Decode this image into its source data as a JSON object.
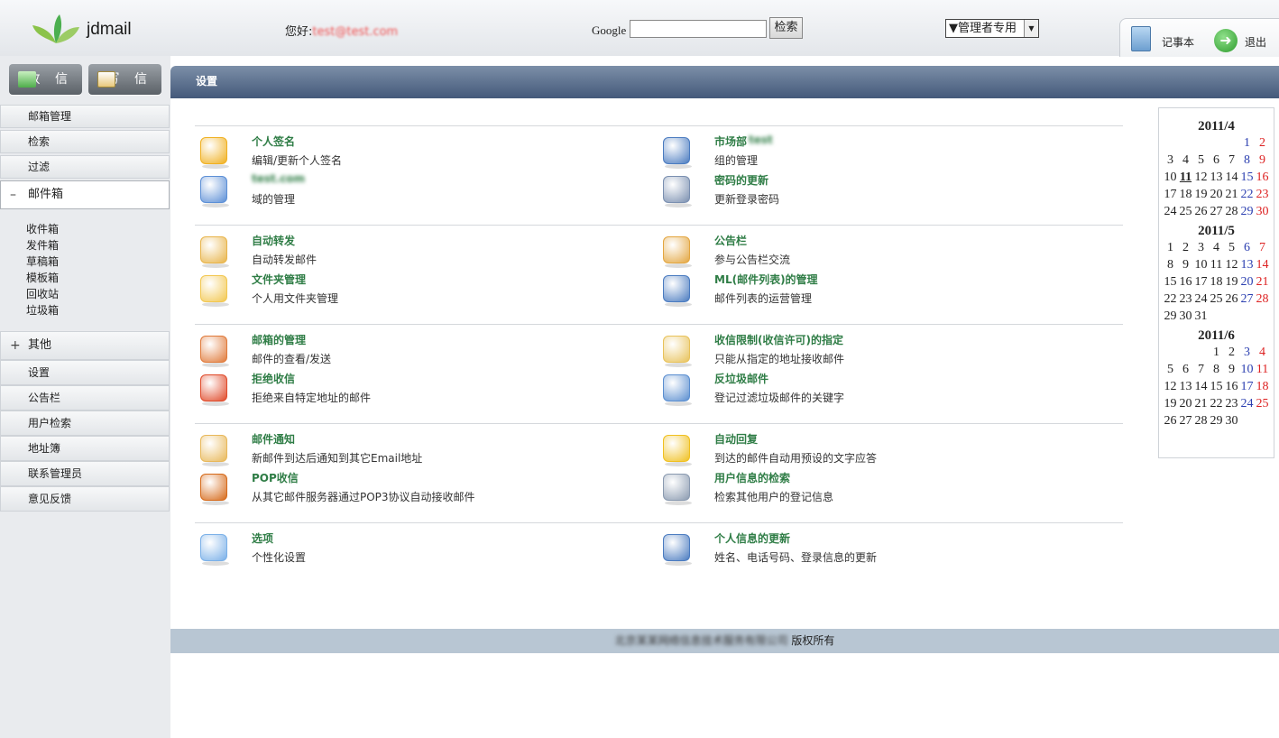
{
  "header": {
    "app_name": "jdmail",
    "greeting_label": "您好:",
    "greeting_user": "test@test.com",
    "google_label": "Google",
    "search_value": "",
    "search_button": "检索",
    "admin_select": "▼管理者专用",
    "notebook_label": "记事本",
    "exit_label": "退出"
  },
  "sidebar": {
    "receive_label": "收 信",
    "write_label": "写 信",
    "items": [
      "邮箱管理",
      "检索",
      "过滤"
    ],
    "mailbox_label": "邮件箱",
    "mailbox_sign": "–",
    "folders": [
      "收件箱",
      "发件箱",
      "草稿箱",
      "模板箱",
      "回收站",
      "垃圾箱"
    ],
    "other_label": "其他",
    "other_sign": "+",
    "other_items": [
      "设置",
      "公告栏",
      "用户检索",
      "地址簿",
      "联系管理员",
      "意见反馈"
    ]
  },
  "main": {
    "title": "设置",
    "rows": [
      {
        "left": [
          {
            "title": "个人签名",
            "desc": "编辑/更新个人签名",
            "icon": "signature-icon",
            "color": "#f0b020"
          },
          {
            "title": "test.com",
            "desc": "域的管理",
            "icon": "domain-card-icon",
            "color": "#5c8fd6",
            "blurred": true
          }
        ],
        "right": [
          {
            "title": "市场部",
            "title_extra": "test",
            "desc": "组的管理",
            "icon": "group-user-icon",
            "color": "#4a7bc0"
          },
          {
            "title": "密码的更新",
            "desc": "更新登录密码",
            "icon": "password-icon",
            "color": "#7a8fb0"
          }
        ]
      },
      {
        "left": [
          {
            "title": "自动转发",
            "desc": "自动转发邮件",
            "icon": "forward-icon",
            "color": "#e8b44a"
          },
          {
            "title": "文件夹管理",
            "desc": "个人用文件夹管理",
            "icon": "folder-icon",
            "color": "#f2c750"
          }
        ],
        "right": [
          {
            "title": "公告栏",
            "desc": "参与公告栏交流",
            "icon": "bulletin-icon",
            "color": "#e3a640"
          },
          {
            "title": "ML(邮件列表)的管理",
            "desc": "邮件列表的运营管理",
            "icon": "mailing-list-icon",
            "color": "#4a7bc0"
          }
        ]
      },
      {
        "left": [
          {
            "title": "邮箱的管理",
            "desc": "邮件的查看/发送",
            "icon": "mailbox-icon",
            "color": "#e07a3a"
          },
          {
            "title": "拒绝收信",
            "desc": "拒绝来自特定地址的邮件",
            "icon": "reject-mail-icon",
            "color": "#e04a2a"
          }
        ],
        "right": [
          {
            "title": "收信限制(收信许可)的指定",
            "desc": "只能从指定的地址接收邮件",
            "icon": "receive-limit-icon",
            "color": "#e8c25a"
          },
          {
            "title": "反垃圾邮件",
            "desc": "登记过滤垃圾邮件的关键字",
            "icon": "trash-can-icon",
            "color": "#5a8ed0"
          }
        ]
      },
      {
        "left": [
          {
            "title": "邮件通知",
            "desc": "新邮件到达后通知到其它Email地址",
            "icon": "mail-notify-icon",
            "color": "#e8b85a"
          },
          {
            "title": "POP收信",
            "desc": "从其它邮件服务器通过POP3协议自动接收邮件",
            "icon": "pop-mail-icon",
            "color": "#d66a1a"
          }
        ],
        "right": [
          {
            "title": "自动回复",
            "desc": "到达的邮件自动用预设的文字应答",
            "icon": "auto-reply-icon",
            "color": "#f0c020"
          },
          {
            "title": "用户信息的检索",
            "desc": "检索其他用户的登记信息",
            "icon": "user-search-icon",
            "color": "#8a9ab0"
          }
        ]
      },
      {
        "left": [
          {
            "title": "选项",
            "desc": "个性化设置",
            "icon": "pointer-hand-icon",
            "color": "#7ab0e8"
          }
        ],
        "right": [
          {
            "title": "个人信息的更新",
            "desc": "姓名、电话号码、登录信息的更新",
            "icon": "user-update-icon",
            "color": "#4a7bc0"
          }
        ]
      }
    ]
  },
  "calendar": {
    "months": [
      {
        "label": "2011/4",
        "offset": 5,
        "days": 30,
        "today": 11
      },
      {
        "label": "2011/5",
        "offset": 0,
        "days": 31
      },
      {
        "label": "2011/6",
        "offset": 3,
        "days": 30
      }
    ]
  },
  "footer": {
    "company": "北京某某网络信息技术服务有限公司",
    "rights": "版权所有"
  },
  "colors": {
    "title_green": "#2f7d46",
    "topbar": "#4f6484",
    "footer": "#b8c6d3"
  }
}
